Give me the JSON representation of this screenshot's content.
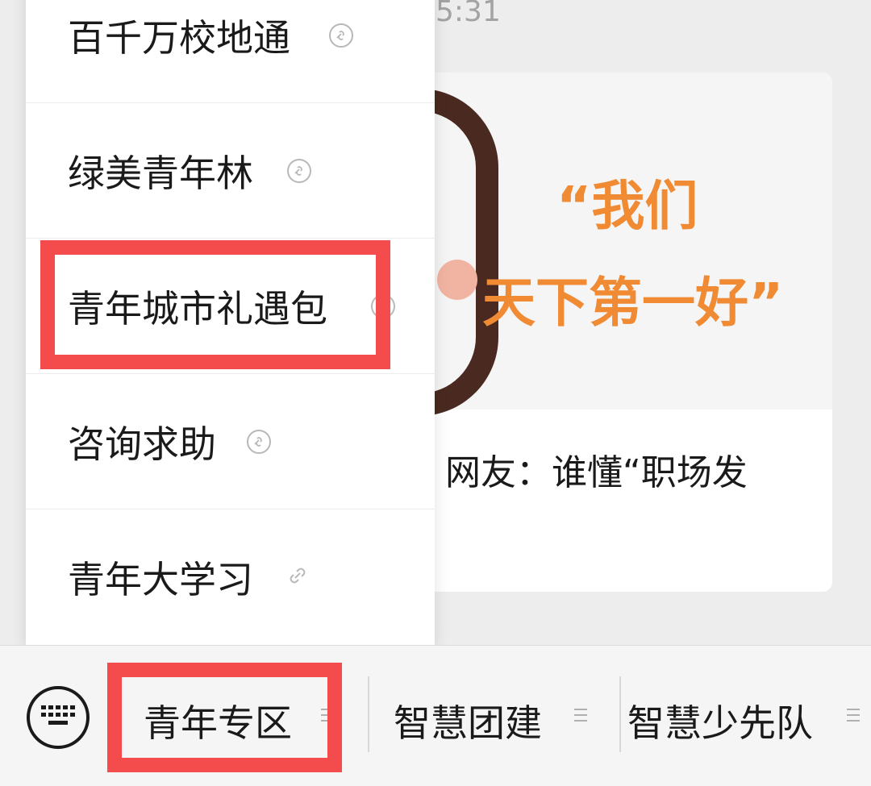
{
  "chat": {
    "timestamp": "5:31"
  },
  "article": {
    "image_slogan_line1": "“我们",
    "image_slogan_line2": "天下第一好”",
    "title": "网友：谁懂“职场发"
  },
  "menu": {
    "items": [
      {
        "label": "百千万校地通",
        "icon": "mini-program-icon"
      },
      {
        "label": "绿美青年林",
        "icon": "mini-program-icon"
      },
      {
        "label": "青年城市礼遇包",
        "icon": "mini-program-icon"
      },
      {
        "label": "咨询求助",
        "icon": "mini-program-icon"
      },
      {
        "label": "青年大学习",
        "icon": "link-icon"
      }
    ]
  },
  "bottom_bar": {
    "keyboard_icon": "keyboard-icon",
    "tabs": [
      {
        "label": "青年专区"
      },
      {
        "label": "智慧团建"
      },
      {
        "label": "智慧少先队"
      }
    ]
  },
  "colors": {
    "highlight": "#f44c4c",
    "slogan": "#f08a33"
  }
}
